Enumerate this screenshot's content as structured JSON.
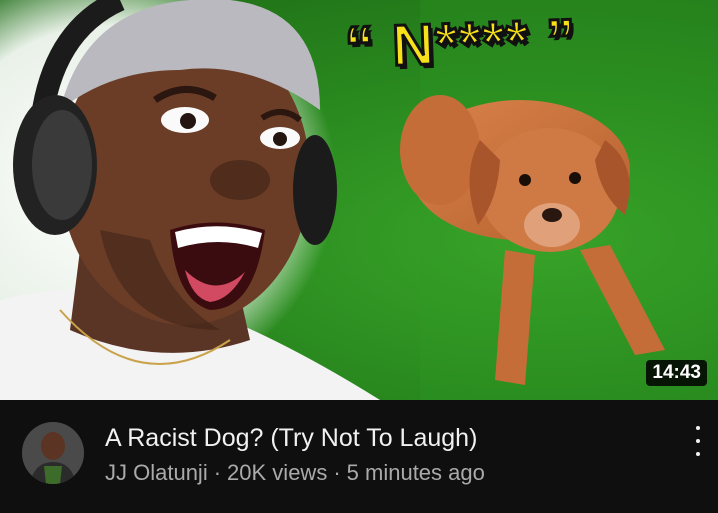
{
  "video": {
    "thumbnail_caption": "“ N**** ”",
    "duration": "14:43",
    "title": "A Racist Dog? (Try Not To Laugh)",
    "channel": "JJ Olatunji",
    "views": "20K views",
    "age": "5 minutes ago",
    "separator": "·"
  },
  "icons": {
    "menu": "more-vert-icon"
  },
  "colors": {
    "background": "#0f0f0f",
    "title_text": "#f1f1f1",
    "meta_text": "#aaaaaa",
    "caption_yellow": "#f7e11b",
    "grass_green": "#2a8a1f"
  }
}
